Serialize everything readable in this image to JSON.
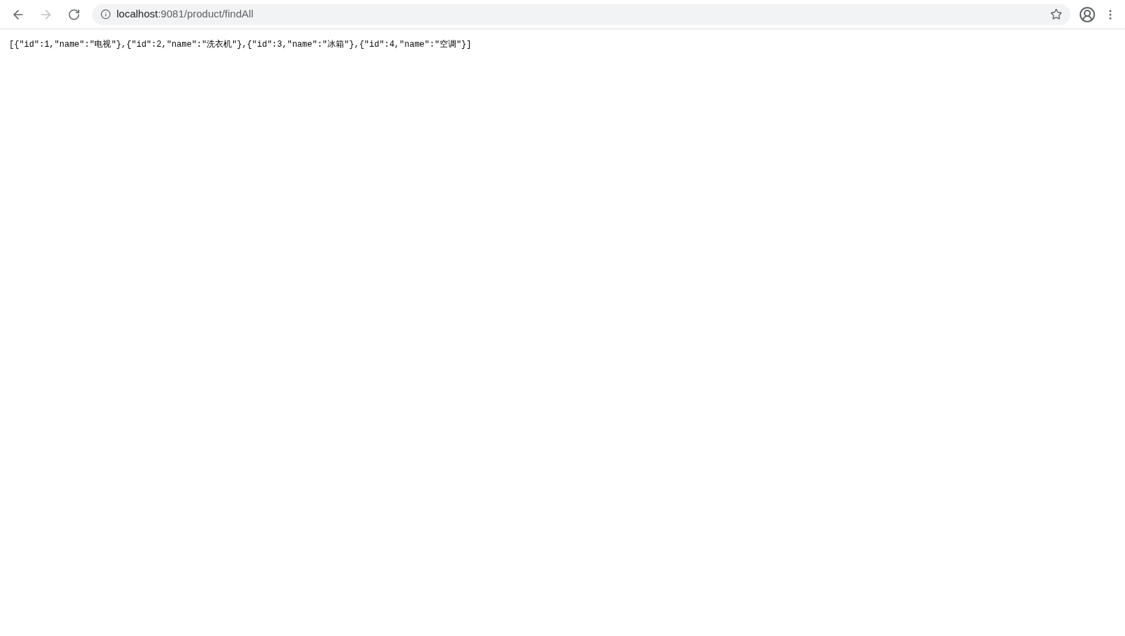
{
  "toolbar": {
    "back_enabled": true,
    "forward_enabled": false,
    "url_host": "localhost",
    "url_path": ":9081/product/findAll",
    "bookmarked": false
  },
  "body": {
    "text": "[{\"id\":1,\"name\":\"电视\"},{\"id\":2,\"name\":\"洗衣机\"},{\"id\":3,\"name\":\"冰箱\"},{\"id\":4,\"name\":\"空调\"}]"
  }
}
